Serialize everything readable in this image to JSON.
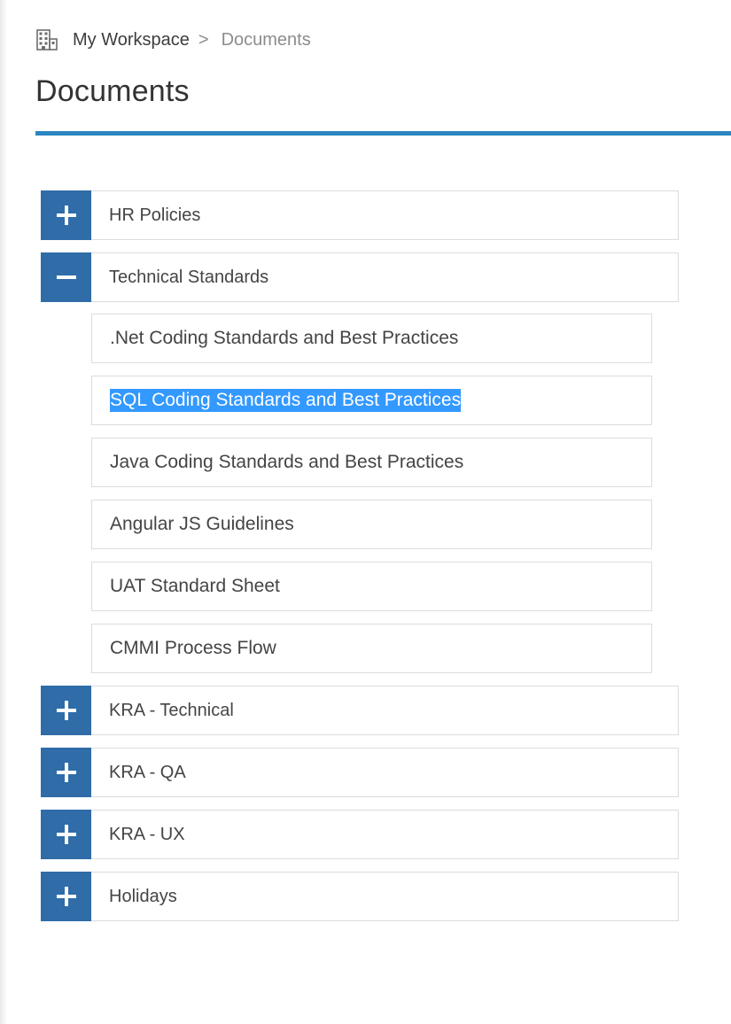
{
  "breadcrumb": {
    "home_icon": "building-icon",
    "home_label": "My Workspace",
    "separator": ">",
    "current_label": "Documents"
  },
  "page": {
    "title": "Documents",
    "accent_color": "#2a86c1",
    "toggle_color": "#2f6ca8"
  },
  "tree": {
    "categories": [
      {
        "label": "HR Policies",
        "state": "collapsed",
        "icon": "plus-icon"
      },
      {
        "label": "Technical Standards",
        "state": "expanded",
        "icon": "minus-icon",
        "children": [
          {
            "label": ".Net Coding Standards and Best Practices"
          },
          {
            "label": "SQL Coding Standards and Best Practices",
            "selected": true
          },
          {
            "label": "Java Coding Standards and Best Practices"
          },
          {
            "label": "Angular JS Guidelines"
          },
          {
            "label": "UAT Standard Sheet"
          },
          {
            "label": "CMMI Process Flow"
          }
        ]
      },
      {
        "label": "KRA - Technical",
        "state": "collapsed",
        "icon": "plus-icon"
      },
      {
        "label": "KRA - QA",
        "state": "collapsed",
        "icon": "plus-icon"
      },
      {
        "label": "KRA - UX",
        "state": "collapsed",
        "icon": "plus-icon"
      },
      {
        "label": "Holidays",
        "state": "collapsed",
        "icon": "plus-icon"
      }
    ]
  }
}
